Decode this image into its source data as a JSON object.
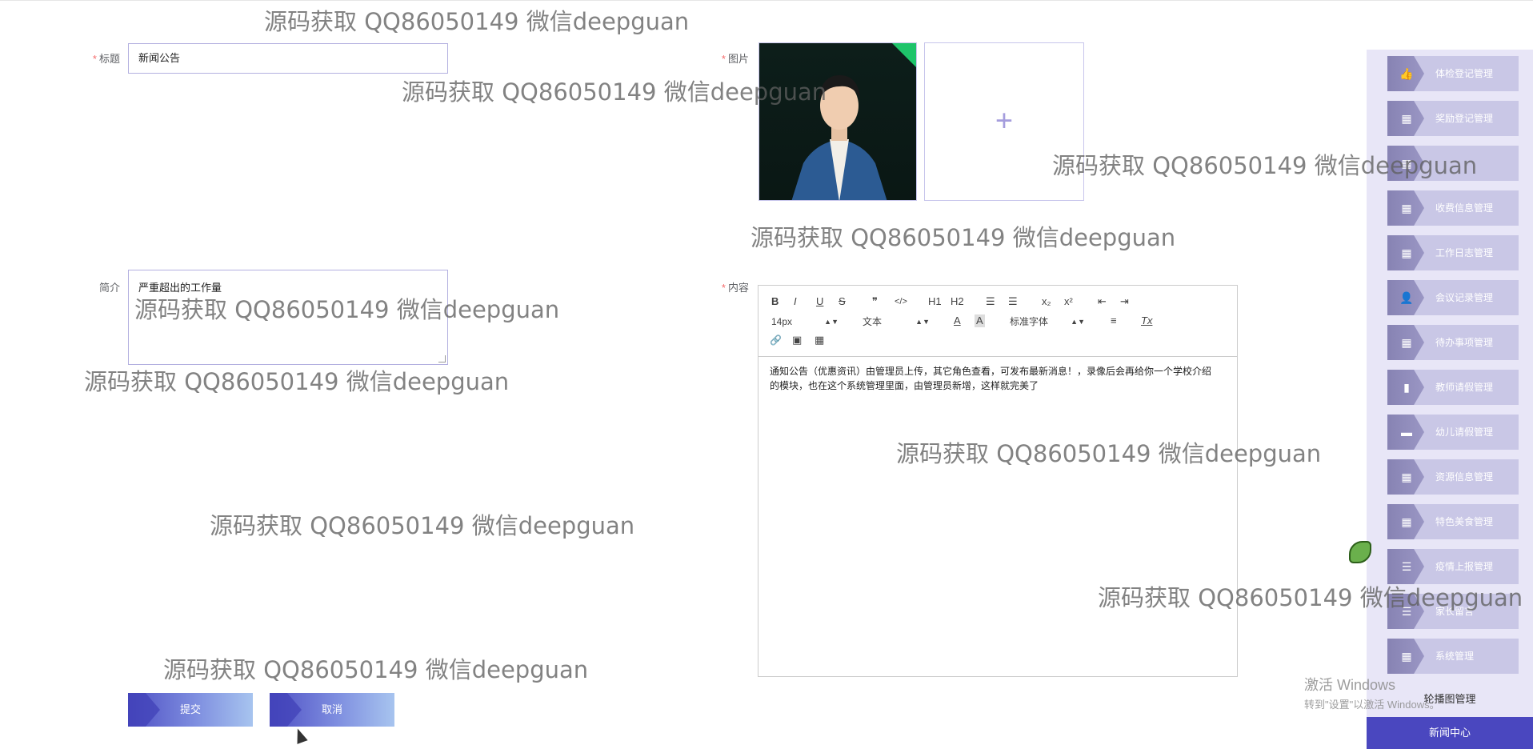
{
  "form": {
    "title_label": "标题",
    "title_value": "新闻公告",
    "image_label": "图片",
    "intro_label": "简介",
    "intro_value": "严重超出的工作量",
    "content_label": "内容",
    "required_mark": "*",
    "upload_plus": "+"
  },
  "editor": {
    "bold": "B",
    "italic": "I",
    "underline": "U",
    "strike": "S",
    "quote": "❞",
    "code": "</>",
    "h1": "H1",
    "h2": "H2",
    "ol": "☰",
    "ul": "☰",
    "sub": "x₂",
    "sup": "x²",
    "outdent": "⇤",
    "indent": "⇥",
    "size_value": "14px",
    "block_value": "文本",
    "font_value": "标准字体",
    "link": "🔗",
    "image": "▣",
    "video": "▦",
    "color_a": "A",
    "bg_a": "A",
    "align": "≡",
    "clear": "Tx",
    "body_text": "通知公告（优惠资讯）由管理员上传，其它角色查看，可发布最新消息！，录像后会再给你一个学校介绍 的模块，也在这个系统管理里面，由管理员新增，这样就完美了"
  },
  "sidebar": {
    "items": [
      {
        "label": "体检登记管理",
        "icon": "thumb-icon"
      },
      {
        "label": "奖励登记管理",
        "icon": "grid-icon"
      },
      {
        "label": "",
        "icon": "grid-icon"
      },
      {
        "label": "收费信息管理",
        "icon": "grid-icon"
      },
      {
        "label": "工作日志管理",
        "icon": "grid-icon"
      },
      {
        "label": "会议记录管理",
        "icon": "user-icon"
      },
      {
        "label": "待办事项管理",
        "icon": "grid-icon"
      },
      {
        "label": "教师请假管理",
        "icon": "chart-icon"
      },
      {
        "label": "幼儿请假管理",
        "icon": "briefcase-icon"
      },
      {
        "label": "资源信息管理",
        "icon": "grid-icon"
      },
      {
        "label": "特色美食管理",
        "icon": "grid-icon"
      },
      {
        "label": "疫情上报管理",
        "icon": "list-icon"
      },
      {
        "label": "家长留言",
        "icon": "list-icon"
      },
      {
        "label": "系统管理",
        "icon": "grid-icon"
      }
    ],
    "carousel_label": "轮播图管理",
    "active_label": "新闻中心"
  },
  "buttons": {
    "submit": "提交",
    "cancel": "取消"
  },
  "watermark": "源码获取 QQ86050149 微信deepguan",
  "windows": {
    "activate": "激活 Windows",
    "hint": "转到\"设置\"以激活 Windows。"
  }
}
